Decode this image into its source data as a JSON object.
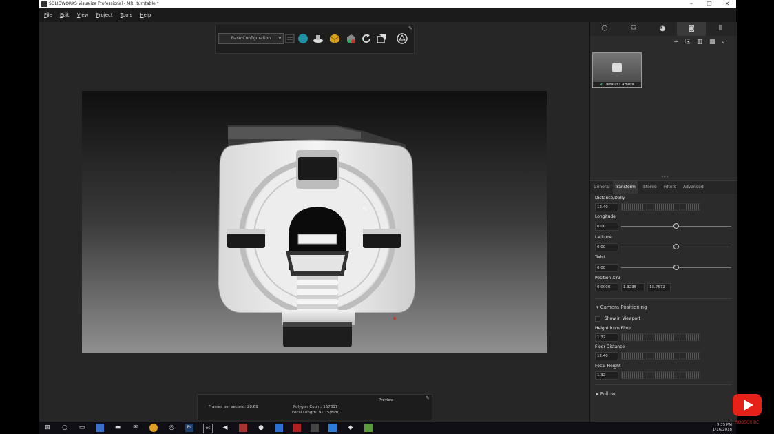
{
  "window": {
    "title": "SOLIDWORKS Visualize Professional - MRI_turntable *",
    "controls": [
      "–",
      "❐",
      "✕"
    ]
  },
  "menu": [
    "File",
    "Edit",
    "View",
    "Project",
    "Tools",
    "Help"
  ],
  "toolbar": {
    "configuration": "Base Configuration",
    "icons": [
      "list-icon",
      "environment-sphere-icon",
      "floor-icon",
      "material-cube-icon",
      "appearance-icon",
      "refresh-icon",
      "camera-add-icon",
      "render-mode-icon",
      "pin-icon"
    ]
  },
  "stats": {
    "fps": "Frames per second: 28.69",
    "polygons": "Polygon Count: 167817",
    "focal_length": "Focal Length: 91.15(mm)",
    "mode": "Preview"
  },
  "palette": {
    "tabs": [
      "model-icon",
      "library-icon",
      "appearance-icon",
      "camera-icon",
      "filmstrip-icon"
    ],
    "active_tab": 3,
    "actions": [
      "+",
      "⎘",
      "▥",
      "▦",
      "⌕"
    ],
    "camera": {
      "name": "Default Camera"
    },
    "prop_tabs": [
      "General",
      "Transform",
      "Stereo",
      "Filters",
      "Advanced"
    ],
    "active_prop_tab": "Transform",
    "transform": {
      "distance_label": "Distance/Dolly",
      "distance_value": "12.40",
      "longitude_label": "Longitude",
      "longitude_value": "0.00",
      "latitude_label": "Latitude",
      "latitude_value": "0.00",
      "twist_label": "Twist",
      "twist_value": "0.00",
      "position_label": "Position XYZ",
      "pos_x": "0.0000",
      "pos_y": "1.3235",
      "pos_z": "13.7572"
    },
    "camera_positioning": {
      "section": "Camera Positioning",
      "show_in_viewport": "Show in Viewport",
      "height_label": "Height from Floor",
      "height_value": "1.32",
      "floor_distance_label": "Floor Distance",
      "floor_distance_value": "12.40",
      "focal_height_label": "Focal Height",
      "focal_height_value": "1.32"
    },
    "follow": "Follow"
  },
  "taskbar": {
    "time": "9:35 PM",
    "date": "1/16/2018"
  },
  "subscribe": "SUBSCRIBE"
}
